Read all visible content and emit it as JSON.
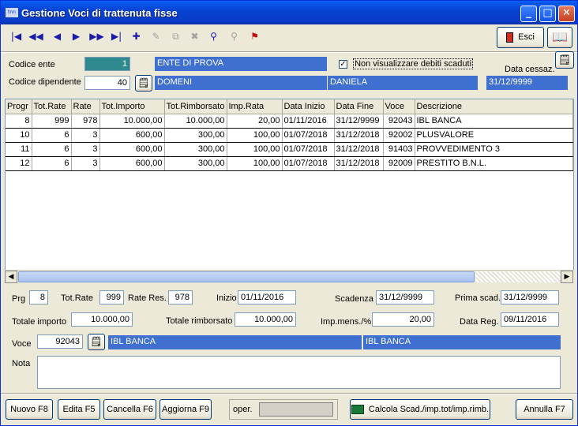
{
  "window": {
    "title": "Gestione Voci di trattenuta fisse",
    "app_icon_text": "tnn"
  },
  "toolbar": {
    "esci_label": "Esci",
    "icons": [
      "first-icon",
      "prev-page-icon",
      "prev-icon",
      "next-icon",
      "next-page-icon",
      "last-icon",
      "new-record-icon",
      "edit-icon",
      "copy-icon",
      "delete-icon",
      "search-icon",
      "search-disabled-icon",
      "filter-icon"
    ]
  },
  "header": {
    "codice_ente_label": "Codice ente",
    "codice_ente_value": "1",
    "ente_name": "ENTE DI PROVA",
    "codice_dipendente_label": "Codice dipendente",
    "codice_dipendente_value": "40",
    "cognome": "DOMENI",
    "nome": "DANIELA",
    "checkbox_label": "Non visualizzare debiti scaduti",
    "checkbox_checked": true,
    "data_cessaz_label": "Data cessaz.",
    "data_cessaz_value": "31/12/9999"
  },
  "grid": {
    "columns": [
      "Progr",
      "Tot.Rate",
      "Rate",
      "Tot.Importo",
      "Tot.Rimborsato",
      "Imp.Rata",
      "Data Inizio",
      "Data Fine",
      "Voce",
      "Descrizione"
    ],
    "rows": [
      [
        "8",
        "999",
        "978",
        "10.000,00",
        "10.000,00",
        "20,00",
        "01/11/2016",
        "31/12/9999",
        "92043",
        "IBL BANCA"
      ],
      [
        "10",
        "6",
        "3",
        "600,00",
        "300,00",
        "100,00",
        "01/07/2018",
        "31/12/2018",
        "92002",
        "PLUSVALORE"
      ],
      [
        "11",
        "6",
        "3",
        "600,00",
        "300,00",
        "100,00",
        "01/07/2018",
        "31/12/2018",
        "91403",
        "PROVVEDIMENTO 3"
      ],
      [
        "12",
        "6",
        "3",
        "600,00",
        "300,00",
        "100,00",
        "01/07/2018",
        "31/12/2018",
        "92009",
        "PRESTITO B.N.L."
      ]
    ]
  },
  "detail": {
    "prg_label": "Prg",
    "prg_value": "8",
    "tot_rate_label": "Tot.Rate",
    "tot_rate_value": "999",
    "rate_res_label": "Rate Res.",
    "rate_res_value": "978",
    "inizio_label": "Inizio",
    "inizio_value": "01/11/2016",
    "scadenza_label": "Scadenza",
    "scadenza_value": "31/12/9999",
    "prima_scad_label": "Prima scad.",
    "prima_scad_value": "31/12/9999",
    "totale_importo_label": "Totale importo",
    "totale_importo_value": "10.000,00",
    "totale_rimborsato_label": "Totale rimborsato",
    "totale_rimborsato_value": "10.000,00",
    "imp_mens_label": "Imp.mens./%",
    "imp_mens_value": "20,00",
    "data_reg_label": "Data Reg.",
    "data_reg_value": "09/11/2016",
    "voce_label": "Voce",
    "voce_value": "92043",
    "voce_desc1": "IBL BANCA",
    "voce_desc2": "IBL BANCA",
    "nota_label": "Nota",
    "nota_value": ""
  },
  "footer": {
    "nuovo": "Nuovo F8",
    "edita": "Edita F5",
    "cancella": "Cancella F6",
    "aggiorna": "Aggiorna F9",
    "oper_label": "oper.",
    "oper_value": "",
    "calcola": "Calcola Scad./imp.tot/imp.rimb.",
    "annulla": "Annulla F7"
  }
}
